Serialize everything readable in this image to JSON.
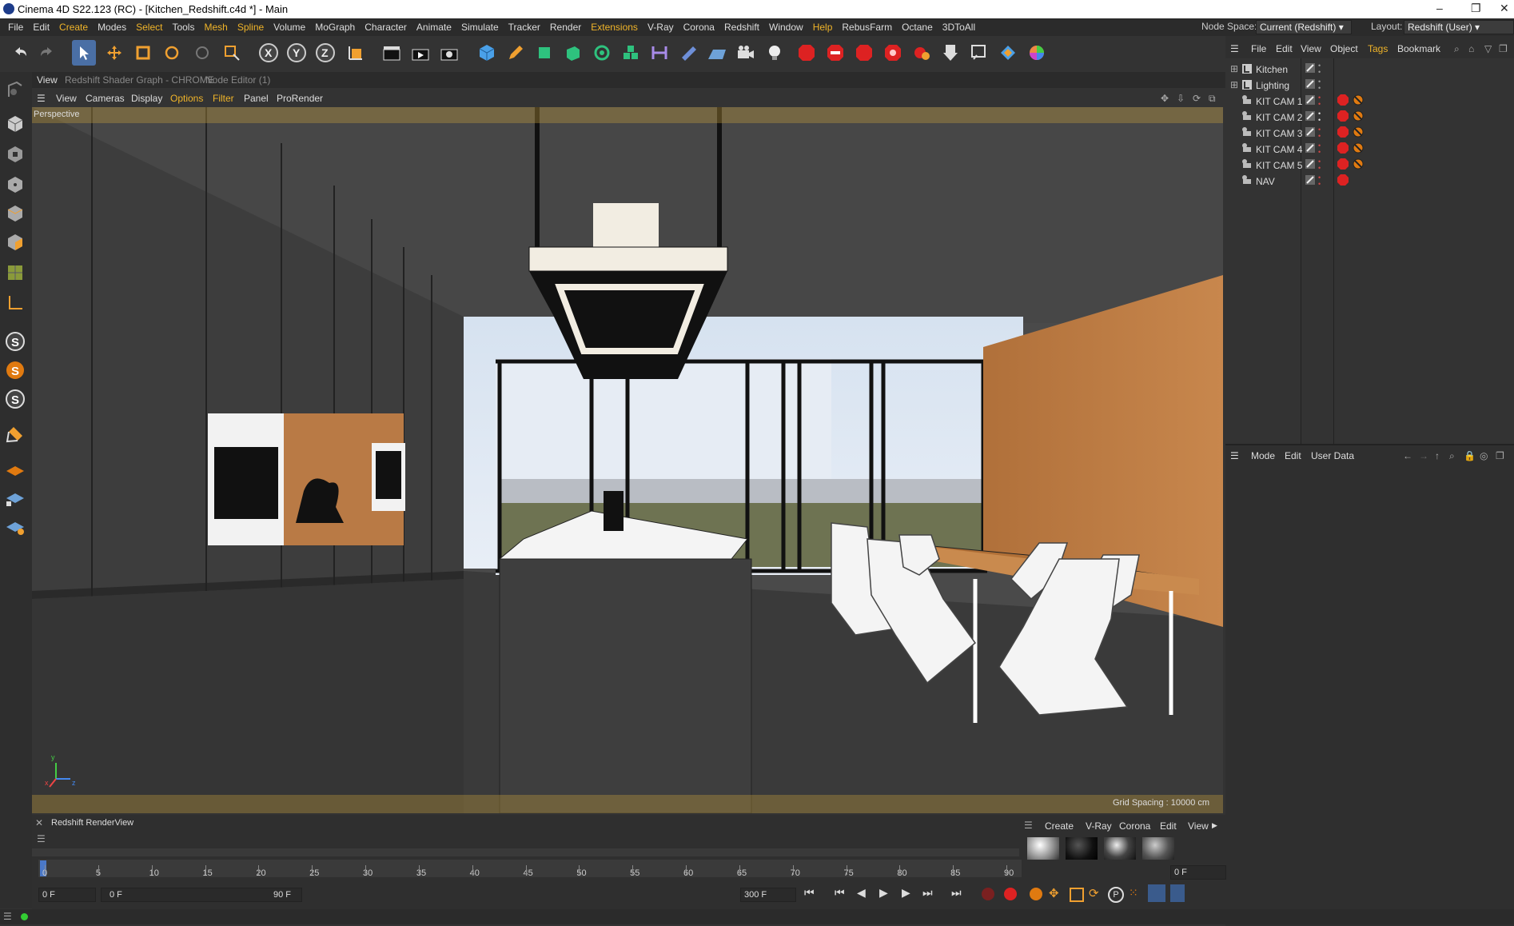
{
  "window": {
    "title": "Cinema 4D S22.123 (RC) - [Kitchen_Redshift.c4d *] - Main",
    "controls": [
      "–",
      "❐",
      "✕"
    ]
  },
  "menubar": {
    "items": [
      "File",
      "Edit",
      "Create",
      "Modes",
      "Select",
      "Tools",
      "Mesh",
      "Spline",
      "Volume",
      "MoGraph",
      "Character",
      "Animate",
      "Simulate",
      "Tracker",
      "Render",
      "Extensions",
      "V-Ray",
      "Corona",
      "Redshift",
      "Window",
      "Help",
      "RebusFarm",
      "Octane",
      "3DToAll"
    ],
    "highlighted": [
      "Create",
      "Select",
      "Mesh",
      "Spline",
      "Extensions",
      "Help"
    ],
    "node_space_label": "Node Space:",
    "node_space_value": "Current (Redshift)",
    "layout_label": "Layout:",
    "layout_value": "Redshift (User)"
  },
  "view_tabs": {
    "items": [
      "View",
      "Redshift Shader Graph - CHROME",
      "Node Editor (1)"
    ]
  },
  "view_menu": {
    "items": [
      "View",
      "Cameras",
      "Display",
      "Options",
      "Filter",
      "Panel",
      "ProRender"
    ]
  },
  "viewport": {
    "label": "Perspective",
    "grid_spacing": "Grid Spacing : 10000 cm",
    "axis_x": "x",
    "axis_y": "y",
    "axis_z": "z"
  },
  "object_manager": {
    "menu": [
      "File",
      "Edit",
      "View",
      "Object",
      "Tags",
      "Bookmark"
    ],
    "objects": [
      {
        "name": "Kitchen",
        "type": "layer"
      },
      {
        "name": "Lighting",
        "type": "layer"
      },
      {
        "name": "KIT CAM 1",
        "type": "camera"
      },
      {
        "name": "KIT CAM 2",
        "type": "camera"
      },
      {
        "name": "KIT CAM 3",
        "type": "camera"
      },
      {
        "name": "KIT CAM 4",
        "type": "camera"
      },
      {
        "name": "KIT CAM 5",
        "type": "camera"
      },
      {
        "name": "NAV",
        "type": "camera"
      }
    ]
  },
  "attributes": {
    "menu": [
      "Mode",
      "Edit",
      "User Data"
    ]
  },
  "renderview": {
    "title": "Redshift RenderView"
  },
  "material_manager": {
    "menu": [
      "Create",
      "V-Ray",
      "Corona",
      "Edit",
      "View"
    ]
  },
  "timeline": {
    "ticks": [
      "0",
      "5",
      "10",
      "15",
      "20",
      "25",
      "30",
      "35",
      "40",
      "45",
      "50",
      "55",
      "60",
      "65",
      "70",
      "75",
      "80",
      "85",
      "90"
    ],
    "current_frame_field": "0 F",
    "current_frame_right": "0 F",
    "range_start": "0 F",
    "range_end": "90 F",
    "range_label_start": "0 F",
    "max_frames": "300 F"
  },
  "colors": {
    "accent": "#f0b429",
    "panel": "#2f2f2f",
    "toolbar": "#333333"
  }
}
